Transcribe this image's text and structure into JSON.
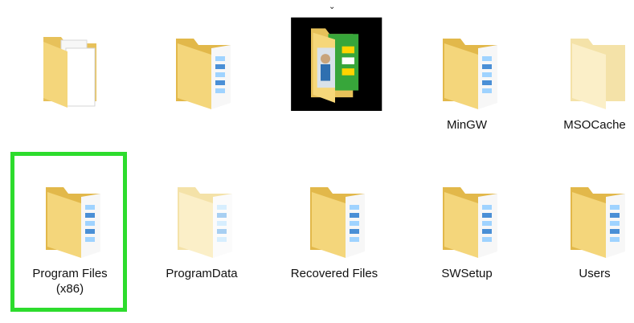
{
  "window": {
    "title": ""
  },
  "items": [
    {
      "label": "",
      "icon": "folder-with-documents-icon",
      "variant": "docs-white",
      "selected": false
    },
    {
      "label": "",
      "icon": "folder-with-blue-stripe-icon",
      "variant": "normal",
      "selected": false
    },
    {
      "label": "",
      "icon": "folder-with-photo-thumbnail-icon",
      "variant": "photo",
      "selected": false
    },
    {
      "label": "MinGW",
      "icon": "folder-with-blue-stripe-icon",
      "variant": "normal",
      "selected": false
    },
    {
      "label": "MSOCache",
      "icon": "folder-faded-icon",
      "variant": "faded-empty",
      "selected": false
    },
    {
      "label": "Program Files\n(x86)",
      "icon": "folder-with-blue-stripe-icon",
      "variant": "normal",
      "selected": true
    },
    {
      "label": "ProgramData",
      "icon": "folder-faded-with-stripe-icon",
      "variant": "faded-stripe",
      "selected": false
    },
    {
      "label": "Recovered Files",
      "icon": "folder-with-blue-stripe-icon",
      "variant": "normal",
      "selected": false
    },
    {
      "label": "SWSetup",
      "icon": "folder-with-blue-stripe-icon",
      "variant": "normal",
      "selected": false
    },
    {
      "label": "Users",
      "icon": "folder-with-blue-stripe-icon",
      "variant": "normal",
      "selected": false
    }
  ],
  "colors": {
    "folder_back": "#e8c24d",
    "folder_front": "#f6d77a",
    "folder_faded_back": "#f4e2a8",
    "folder_faded_front": "#fbefc8",
    "selection": "#2ddc2d",
    "stripe_blue": "#4a8fd6"
  }
}
